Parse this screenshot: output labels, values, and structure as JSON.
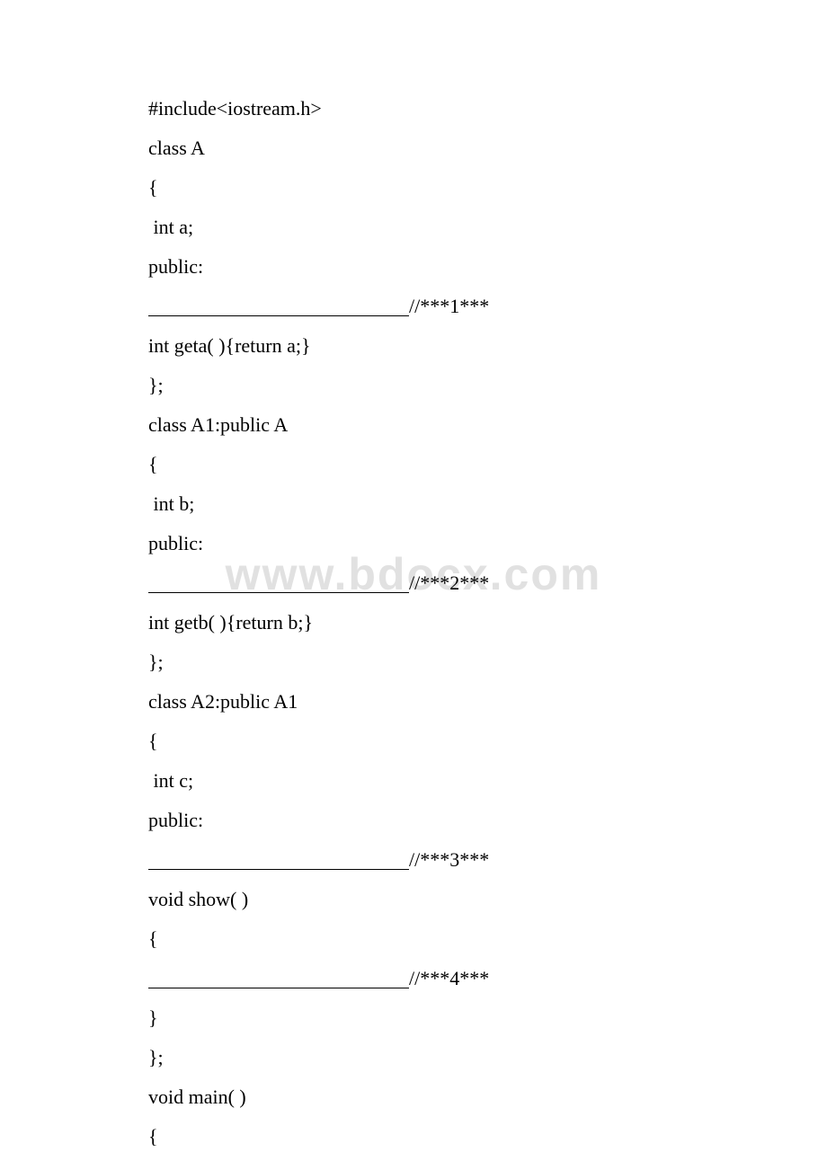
{
  "watermark": "www.bdocx.com",
  "code": {
    "line1": "#include<iostream.h>",
    "line2": "class A",
    "line3": "{",
    "line4": " int a;",
    "line5": "public:",
    "comment1": "//***1***",
    "line7": "int geta( ){return a;}",
    "line8": "};",
    "line9": "class A1:public A",
    "line10": "{",
    "line11": " int b;",
    "line12": "public:",
    "comment2": "//***2***",
    "line14": "int getb( ){return b;}",
    "line15": "};",
    "line16": "class A2:public A1",
    "line17": "{",
    "line18": " int c;",
    "line19": "public:",
    "comment3": "//***3***",
    "line21": "void show( )",
    "line22": "{",
    "comment4": "//***4***",
    "line24": "}",
    "line25": "};",
    "line26": "void main( )",
    "line27": "{"
  }
}
